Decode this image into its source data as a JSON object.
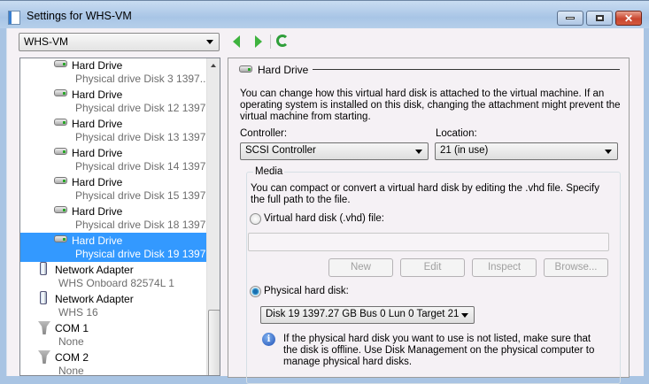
{
  "window": {
    "title": "Settings for WHS-VM",
    "minimize": "minimize",
    "maximize": "maximize",
    "close": "close"
  },
  "vm_selector": {
    "value": "WHS-VM"
  },
  "tree": [
    {
      "label": "Hard Drive",
      "sub": "Physical drive Disk 3 1397....",
      "type": "drive"
    },
    {
      "label": "Hard Drive",
      "sub": "Physical drive Disk 12 1397...",
      "type": "drive"
    },
    {
      "label": "Hard Drive",
      "sub": "Physical drive Disk 13 1397...",
      "type": "drive"
    },
    {
      "label": "Hard Drive",
      "sub": "Physical drive Disk 14 1397...",
      "type": "drive"
    },
    {
      "label": "Hard Drive",
      "sub": "Physical drive Disk 15 1397...",
      "type": "drive"
    },
    {
      "label": "Hard Drive",
      "sub": "Physical drive Disk 18 1397...",
      "type": "drive"
    },
    {
      "label": "Hard Drive",
      "sub": "Physical drive Disk 19 1397...",
      "type": "drive",
      "selected": true
    },
    {
      "label": "Network Adapter",
      "sub": "WHS Onboard 82574L 1",
      "type": "net"
    },
    {
      "label": "Network Adapter",
      "sub": "WHS 16",
      "type": "net"
    },
    {
      "label": "COM 1",
      "sub": "None",
      "type": "com"
    },
    {
      "label": "COM 2",
      "sub": "None",
      "type": "com"
    }
  ],
  "panel": {
    "title": "Hard Drive",
    "description": "You can change how this virtual hard disk is attached to the virtual machine. If an operating system is installed on this disk, changing the attachment might prevent the virtual machine from starting.",
    "controller_label": "Controller:",
    "controller_value": "SCSI Controller",
    "location_label": "Location:",
    "location_value": "21 (in use)",
    "media": {
      "label": "Media",
      "description": "You can compact or convert a virtual hard disk by editing the .vhd file. Specify the full path to the file.",
      "vhd_label": "Virtual hard disk (.vhd) file:",
      "vhd_value": "",
      "buttons": {
        "new": "New",
        "edit": "Edit",
        "inspect": "Inspect",
        "browse": "Browse..."
      },
      "physical_label": "Physical hard disk:",
      "physical_value": "Disk 19 1397.27 GB Bus 0 Lun 0 Target 21",
      "info": "If the physical hard disk you want to use is not listed, make sure that the disk is offline. Use Disk Management on the physical computer to manage physical hard disks."
    }
  }
}
